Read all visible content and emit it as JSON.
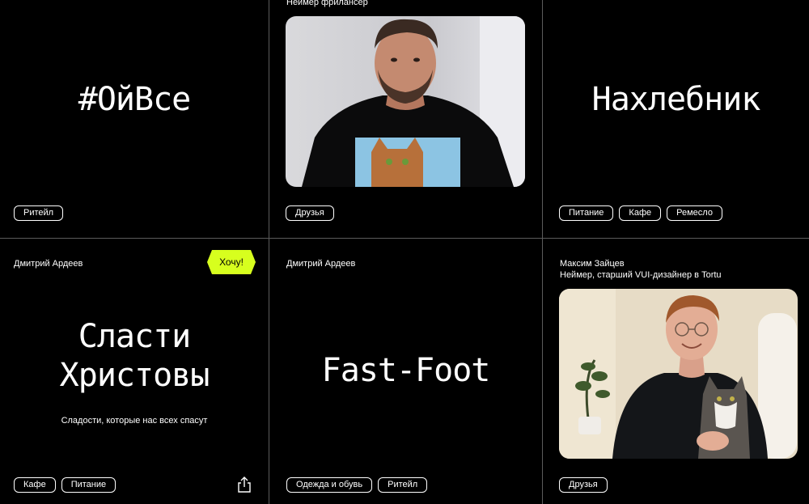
{
  "cards": [
    {
      "title": "#ОйВсе",
      "tags": [
        "Ритейл"
      ]
    },
    {
      "author_line": "Неймер фрилансер",
      "tags": [
        "Друзья"
      ]
    },
    {
      "title": "Нахлебник",
      "tags": [
        "Питание",
        "Кафе",
        "Ремесло"
      ]
    },
    {
      "author": "Дмитрий Ардеев",
      "cta_label": "Хочу!",
      "title_line1": "Сласти",
      "title_line2": "Христовы",
      "subtitle": "Сладости, которые нас всех спасут",
      "tags": [
        "Кафе",
        "Питание"
      ]
    },
    {
      "author": "Дмитрий Ардеев",
      "title": "Fast-Foot",
      "tags": [
        "Одежда и обувь",
        "Ритейл"
      ]
    },
    {
      "author": "Максим Зайцев",
      "author_role": "Неймер, старший VUI-дизайнер в Tortu",
      "tags": [
        "Друзья"
      ]
    }
  ],
  "colors": {
    "background": "#000000",
    "grid_line": "#5c5c5c",
    "cta_accent": "#d7ff1e",
    "text": "#ffffff"
  },
  "icons": [
    "share-icon"
  ]
}
